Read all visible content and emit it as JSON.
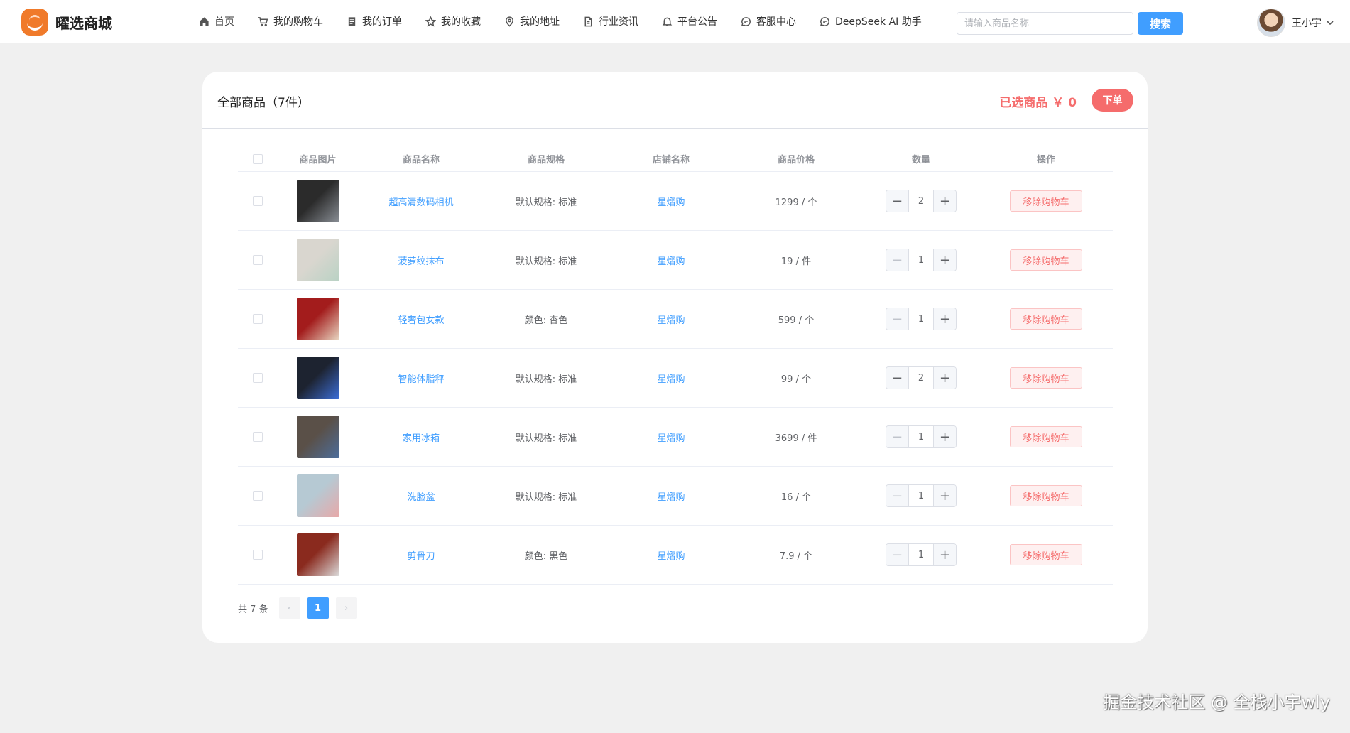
{
  "header": {
    "logo_text": "曜选商城",
    "nav": [
      {
        "label": "首页",
        "icon": "home-icon"
      },
      {
        "label": "我的购物车",
        "icon": "cart-icon"
      },
      {
        "label": "我的订单",
        "icon": "order-icon"
      },
      {
        "label": "我的收藏",
        "icon": "star-icon"
      },
      {
        "label": "我的地址",
        "icon": "location-icon"
      },
      {
        "label": "行业资讯",
        "icon": "document-icon"
      },
      {
        "label": "平台公告",
        "icon": "bell-icon"
      },
      {
        "label": "客服中心",
        "icon": "chat-icon"
      },
      {
        "label": "DeepSeek AI 助手",
        "icon": "chat-icon"
      }
    ],
    "search_placeholder": "请输入商品名称",
    "search_label": "搜索",
    "user_name": "王小宇"
  },
  "cart": {
    "title": "全部商品（7件）",
    "selected_text": "已选商品 ￥ 0",
    "order_label": "下单",
    "columns": [
      "商品图片",
      "商品名称",
      "商品规格",
      "店铺名称",
      "商品价格",
      "数量",
      "操作"
    ],
    "items": [
      {
        "name": "超高清数码相机",
        "spec": "默认规格: 标准",
        "shop": "星熠购",
        "price": "1299 / 个",
        "qty": "2",
        "remove": "移除购物车",
        "img_colors": [
          "#2b2b2b",
          "#8a8f96"
        ]
      },
      {
        "name": "菠萝纹抹布",
        "spec": "默认规格: 标准",
        "shop": "星熠购",
        "price": "19 / 件",
        "qty": "1",
        "remove": "移除购物车",
        "img_colors": [
          "#d9d6cf",
          "#b9d2c4"
        ]
      },
      {
        "name": "轻奢包女款",
        "spec": "颜色: 杏色",
        "shop": "星熠购",
        "price": "599 / 个",
        "qty": "1",
        "remove": "移除购物车",
        "img_colors": [
          "#a31c1c",
          "#e9d9c4"
        ]
      },
      {
        "name": "智能体脂秤",
        "spec": "默认规格: 标准",
        "shop": "星熠购",
        "price": "99 / 个",
        "qty": "2",
        "remove": "移除购物车",
        "img_colors": [
          "#1d2330",
          "#3d6fd8"
        ]
      },
      {
        "name": "家用冰箱",
        "spec": "默认规格: 标准",
        "shop": "星熠购",
        "price": "3699 / 件",
        "qty": "1",
        "remove": "移除购物车",
        "img_colors": [
          "#5a5048",
          "#4d6e9c"
        ]
      },
      {
        "name": "洗脸盆",
        "spec": "默认规格: 标准",
        "shop": "星熠购",
        "price": "16 / 个",
        "qty": "1",
        "remove": "移除购物车",
        "img_colors": [
          "#b6c9d3",
          "#e8a8a8"
        ]
      },
      {
        "name": "剪骨刀",
        "spec": "颜色: 黑色",
        "shop": "星熠购",
        "price": "7.9 / 个",
        "qty": "1",
        "remove": "移除购物车",
        "img_colors": [
          "#8a2a1e",
          "#dcdcdc"
        ]
      }
    ]
  },
  "pagination": {
    "total": "共 7 条",
    "prev": "‹",
    "page": "1",
    "next": "›"
  },
  "watermark": "掘金技术社区 @ 全栈小宇wly"
}
